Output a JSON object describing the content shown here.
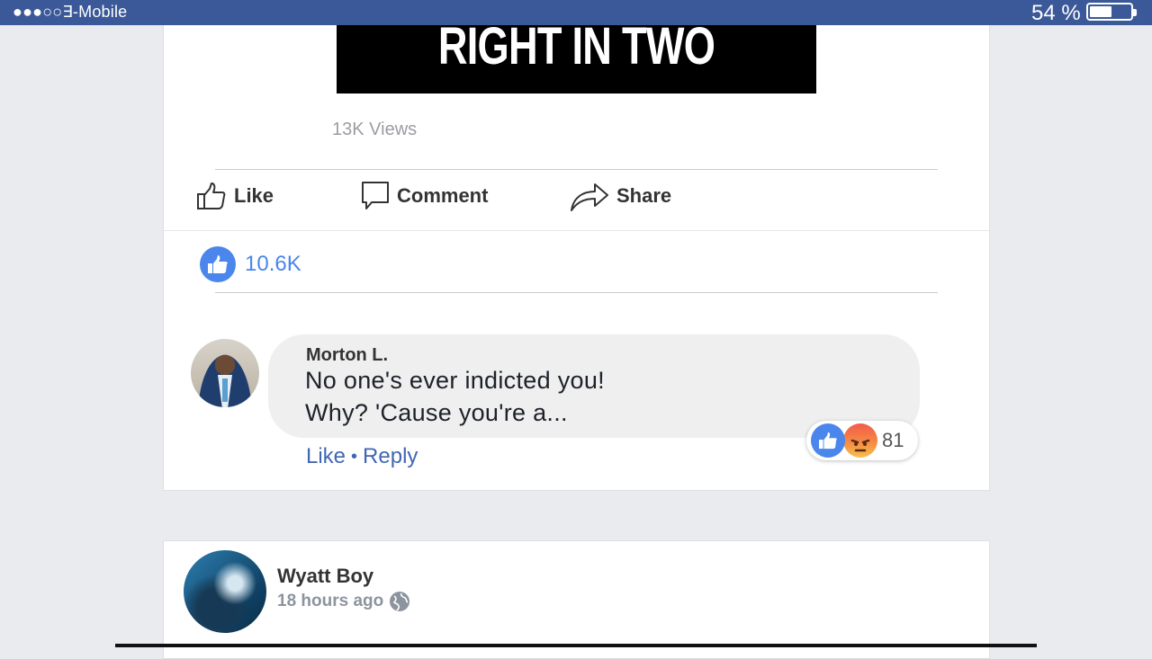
{
  "status_bar": {
    "carrier": "●●●○○∃-Mobile",
    "battery_percent": "54 %",
    "battery_level": 0.54
  },
  "post": {
    "video_caption": "RIGHT IN TWO",
    "views": "13K Views",
    "actions": {
      "like": "Like",
      "comment": "Comment",
      "share": "Share"
    },
    "likes_count": "10.6K",
    "comment": {
      "author": "Morton L.",
      "line1": "No one's ever indicted you!",
      "line2": "Why? 'Cause you're a...",
      "reaction_count": "81",
      "like_label": "Like",
      "separator": "•",
      "reply_label": "Reply"
    }
  },
  "next_post": {
    "author": "Wyatt Boy",
    "time": "18 hours ago"
  },
  "colors": {
    "status_bar": "#3b5998",
    "accent_blue": "#4a86ec",
    "link_blue": "#4267b2"
  }
}
